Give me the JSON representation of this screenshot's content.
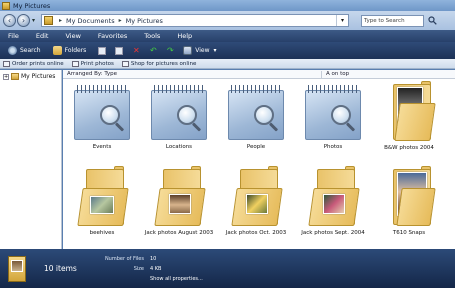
{
  "window": {
    "title": "My Pictures"
  },
  "address": {
    "crumbs": [
      "My Documents",
      "My Pictures"
    ],
    "search_placeholder": "Type to Search"
  },
  "menu": [
    "File",
    "Edit",
    "View",
    "Favorites",
    "Tools",
    "Help"
  ],
  "commands": {
    "search": "Search",
    "folders": "Folders",
    "views": "View"
  },
  "tasks": [
    "Order prints online",
    "Print photos",
    "Shop for pictures online"
  ],
  "tree": {
    "item": "My Pictures"
  },
  "arrange": {
    "label": "Arranged By: Type",
    "group": "A on top"
  },
  "items": [
    {
      "label": "Events",
      "kind": "album"
    },
    {
      "label": "Locations",
      "kind": "album"
    },
    {
      "label": "People",
      "kind": "album"
    },
    {
      "label": "Photos",
      "kind": "album"
    },
    {
      "label": "B&W photos 2004",
      "kind": "folder"
    },
    {
      "label": "beehives",
      "kind": "folder"
    },
    {
      "label": "Jack photos August 2003",
      "kind": "folder"
    },
    {
      "label": "Jack photos Oct. 2003",
      "kind": "folder"
    },
    {
      "label": "Jack photos Sept. 2004",
      "kind": "folder"
    },
    {
      "label": "T610 Snaps",
      "kind": "folder"
    }
  ],
  "status": {
    "count": "10 items",
    "files_label": "Number of Files",
    "files_value": "10",
    "size_label": "Size",
    "size_value": "4 KB",
    "show_all": "Show all properties..."
  }
}
